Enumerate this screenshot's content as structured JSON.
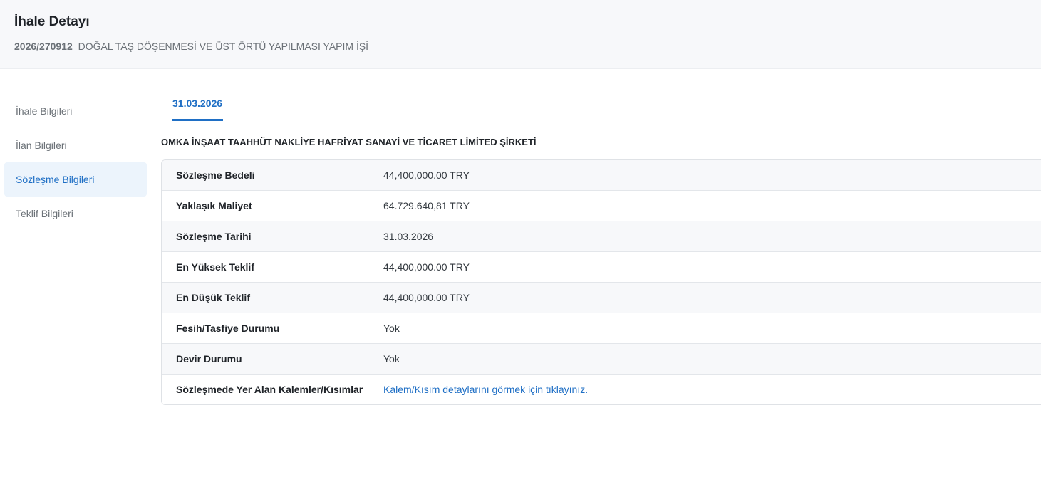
{
  "header": {
    "title": "İhale Detayı",
    "tender_code": "2026/270912",
    "tender_name": "DOĞAL TAŞ DÖŞENMESİ VE ÜST ÖRTÜ YAPILMASI YAPIM İŞİ"
  },
  "sidebar": {
    "items": [
      {
        "label": "İhale Bilgileri",
        "active": false
      },
      {
        "label": "İlan Bilgileri",
        "active": false
      },
      {
        "label": "Sözleşme Bilgileri",
        "active": true
      },
      {
        "label": "Teklif Bilgileri",
        "active": false
      }
    ]
  },
  "tabs": [
    {
      "label": "31.03.2026",
      "active": true
    }
  ],
  "contract": {
    "company": "OMKA İNŞAAT TAAHHÜT NAKLİYE HAFRİYAT SANAYİ VE TİCARET LİMİTED ŞİRKETİ",
    "rows": [
      {
        "label": "Sözleşme Bedeli",
        "value": "44,400,000.00 TRY"
      },
      {
        "label": "Yaklaşık Maliyet",
        "value": "64.729.640,81 TRY"
      },
      {
        "label": "Sözleşme Tarihi",
        "value": "31.03.2026"
      },
      {
        "label": "En Yüksek Teklif",
        "value": "44,400,000.00 TRY"
      },
      {
        "label": "En Düşük Teklif",
        "value": "44,400,000.00 TRY"
      },
      {
        "label": "Fesih/Tasfiye Durumu",
        "value": "Yok"
      },
      {
        "label": "Devir Durumu",
        "value": "Yok"
      },
      {
        "label": "Sözleşmede Yer Alan Kalemler/Kısımlar",
        "value": "Kalem/Kısım detaylarını görmek için tıklayınız."
      }
    ]
  },
  "colors": {
    "accent": "#1f6fc5",
    "header_bg": "#f7f8fa",
    "active_item_bg": "#ecf4fc"
  }
}
